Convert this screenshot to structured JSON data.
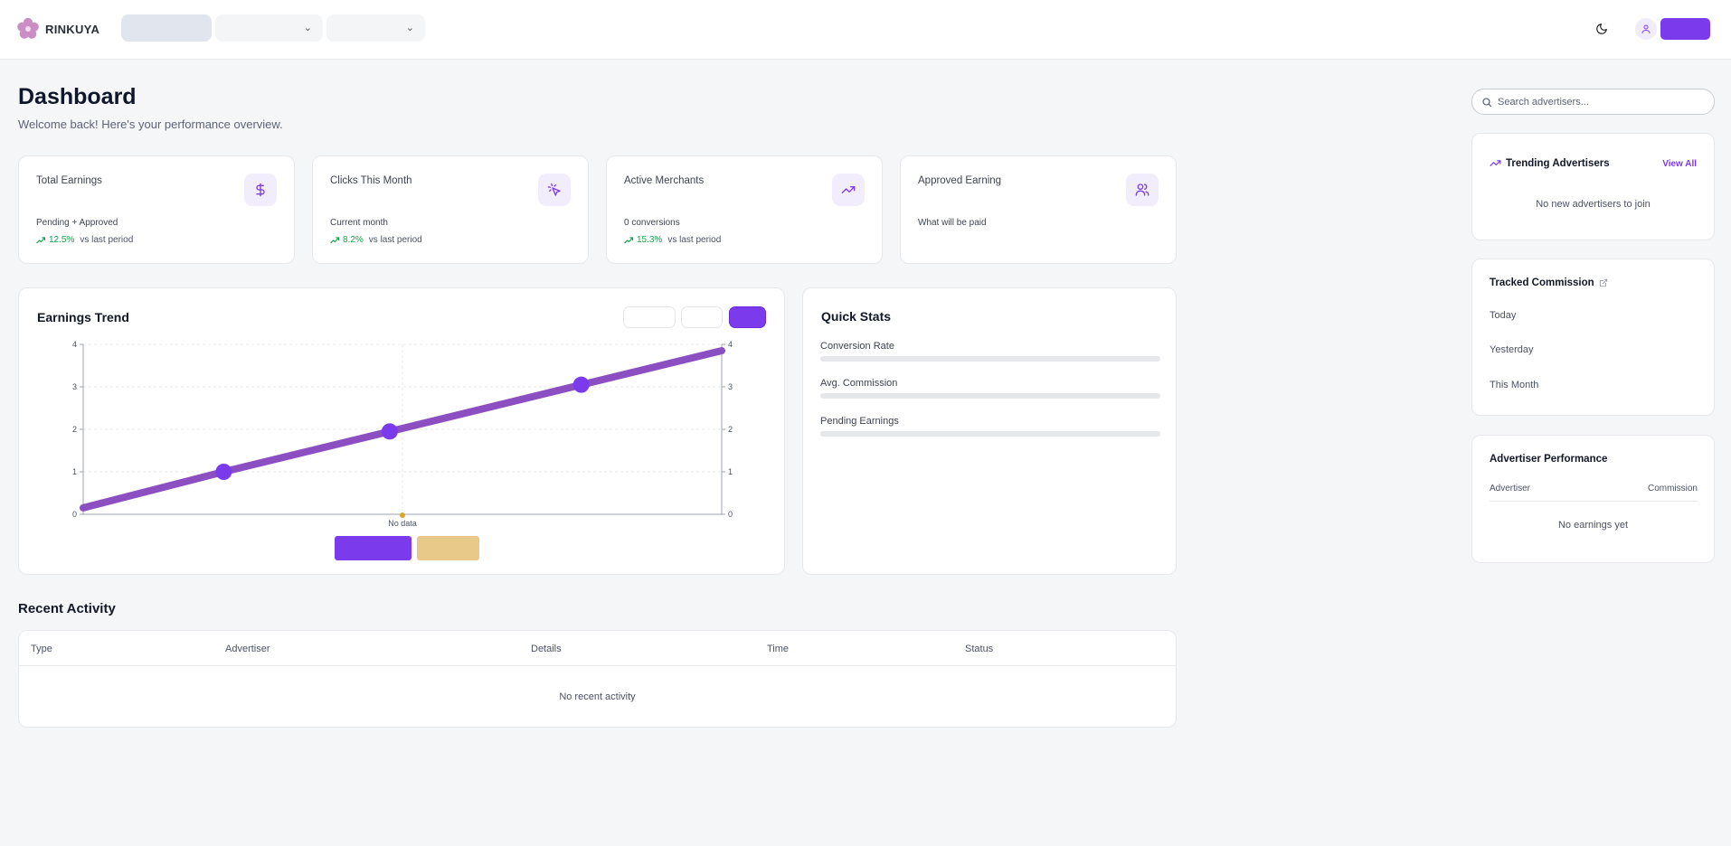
{
  "app": {
    "brand": "RINKUYA"
  },
  "colors": {
    "accent": "#7c3aed",
    "trend_up": "#16a34a",
    "line": "#8b4fc1",
    "legend_secondary": "#e9c98a"
  },
  "header": {
    "title": "Dashboard",
    "subtitle": "Welcome back! Here's your performance overview."
  },
  "stats": [
    {
      "title": "Total Earnings",
      "icon": "dollar-icon",
      "sub": "Pending + Approved",
      "trend": "12.5%",
      "trend_label": "vs last period"
    },
    {
      "title": "Clicks This Month",
      "icon": "cursor-click-icon",
      "sub": "Current month",
      "trend": "8.2%",
      "trend_label": "vs last period"
    },
    {
      "title": "Active Merchants",
      "icon": "trending-up-icon",
      "sub": "0 conversions",
      "trend": "15.3%",
      "trend_label": "vs last period"
    },
    {
      "title": "Approved Earning",
      "icon": "users-icon",
      "sub": "What will be paid"
    }
  ],
  "earnings": {
    "title": "Earnings Trend"
  },
  "chart_data": {
    "type": "line",
    "title": "Earnings Trend",
    "x_tick_labels": [
      "No data"
    ],
    "ylim": [
      0,
      4
    ],
    "y_ticks": [
      0,
      1,
      2,
      3,
      4
    ],
    "y2_ticks": [
      0,
      1,
      2,
      3,
      4
    ],
    "grid": true,
    "series": [
      {
        "points": [
          [
            0,
            0.15
          ],
          [
            0.22,
            1
          ],
          [
            0.48,
            1.95
          ],
          [
            0.78,
            3.05
          ],
          [
            1,
            3.85
          ]
        ]
      }
    ]
  },
  "quick_stats": {
    "title": "Quick Stats",
    "rows": [
      {
        "label": "Conversion Rate"
      },
      {
        "label": "Avg. Commission"
      },
      {
        "label": "Pending Earnings"
      }
    ]
  },
  "recent_activity": {
    "title": "Recent Activity",
    "columns": [
      "Type",
      "Advertiser",
      "Details",
      "Time",
      "Status"
    ],
    "empty": "No recent activity"
  },
  "search": {
    "placeholder": "Search advertisers..."
  },
  "trending": {
    "title": "Trending Advertisers",
    "link": "View All",
    "empty": "No new advertisers to join"
  },
  "tracked": {
    "title": "Tracked Commission",
    "rows": [
      "Today",
      "Yesterday",
      "This Month"
    ]
  },
  "performance": {
    "title": "Advertiser Performance",
    "col_advertiser": "Advertiser",
    "col_commission": "Commission",
    "empty": "No earnings yet"
  }
}
